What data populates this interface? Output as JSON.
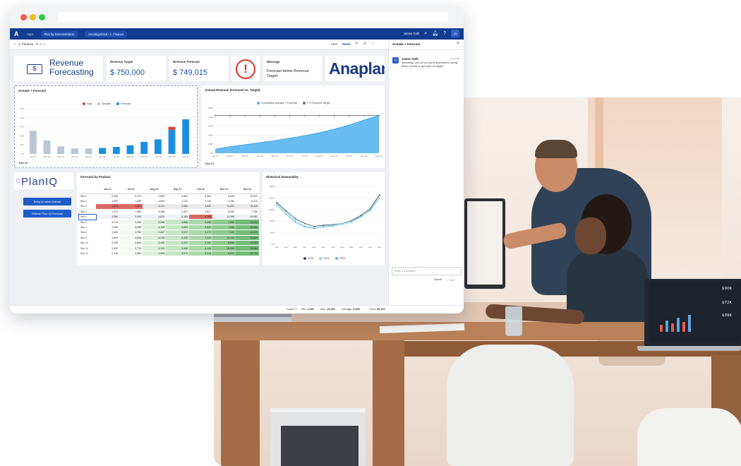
{
  "nav": {
    "logo": "A",
    "crumbs": [
      "Apps",
      "Plan by Demonstration",
      "Uncategorized › 1. Finance"
    ],
    "user": "James Goth",
    "avatar": "JG"
  },
  "toolbar": {
    "title": "1. Finance",
    "view": "View",
    "reset": "Reset"
  },
  "kpis": {
    "revenue_title_line1": "Revenue",
    "revenue_title_line2": "Forecasting",
    "target_label": "Revenue Target",
    "target_value": "$ 750,000",
    "forecast_label": "Revenue Forecast",
    "forecast_value": "$ 749,015",
    "message_label": "Message",
    "message_text": "Forecast below Revenue Target.",
    "brand": "Anaplan"
  },
  "actuals_chart": {
    "title": "Actuals + Forecast",
    "legend": [
      "Gap",
      "Actuals",
      "Forecast"
    ],
    "footer": "Dec 21",
    "colors": {
      "gap": "#d9433b",
      "actuals": "#b9c6d6",
      "forecast": "#1c8ee0"
    }
  },
  "annual_chart": {
    "title": "Annual Revenue (Forecast vs. Target)",
    "legend": [
      "Cumulative Actuals + Forecast",
      "FY Revenue Target"
    ],
    "footer": "Dec 21"
  },
  "planiq": {
    "logo": "PlanIQ",
    "btn_actuals": "Bring in Latest Actuals",
    "btn_refresh": "Refresh Plan IQ Forecast"
  },
  "table": {
    "title": "Forecast by Product",
    "columns": [
      "",
      "Jun 21",
      "Jul 21",
      "Aug 21",
      "Sep 21",
      "Oct 21",
      "Nov 21",
      "Dec 21"
    ],
    "rows": [
      {
        "label": "Sku 1",
        "cells": [
          "2,290",
          "2,374",
          "2,608",
          "4,842",
          "5,304",
          "6,649",
          "12,007"
        ]
      },
      {
        "label": "Sku 2",
        "cells": [
          "1,087",
          "1,698",
          "1,845",
          "2,110",
          "2,743",
          "3,782",
          "6,214"
        ]
      },
      {
        "label": "Sku 3",
        "cells": [
          "2,813",
          "2,891",
          "3,141",
          "3,384",
          "3,849",
          "11,601",
          "15,419"
        ]
      },
      {
        "label": "Sku 4",
        "cells": [
          "1,371",
          "1,486",
          "3,936",
          "3,197",
          "3,817",
          "5,090",
          "7,780"
        ]
      },
      {
        "label": "Sku 5",
        "cells": [
          "3,280",
          "3,394",
          "4,830",
          "5,182",
          "8,153",
          "11,098",
          "19,652"
        ]
      },
      {
        "label": "Sku 6",
        "cells": [
          "3,170",
          "3,259",
          "3,098",
          "4,088",
          "5,458",
          "7,690",
          "13,400"
        ]
      },
      {
        "label": "Sku 7",
        "cells": [
          "2,300",
          "2,535",
          "3,108",
          "3,893",
          "5,830",
          "7,698",
          "10,280"
        ]
      },
      {
        "label": "Sku 8",
        "cells": [
          "1,600",
          "1,781",
          "2,467",
          "3,097",
          "3,372",
          "7,130",
          "11,321"
        ]
      },
      {
        "label": "Sku 9",
        "cells": [
          "2,809",
          "3,028",
          "4,235",
          "5,392",
          "7,239",
          "12,230",
          "16,557"
        ]
      },
      {
        "label": "Sku 10",
        "cells": [
          "2,298",
          "2,614",
          "3,426",
          "4,302",
          "5,251",
          "8,896",
          "13,489"
        ]
      },
      {
        "label": "Sku 11",
        "cells": [
          "2,532",
          "2,713",
          "3,193",
          "3,969",
          "6,128",
          "10,930",
          "15,282"
        ]
      },
      {
        "label": "Sku 12",
        "cells": [
          "2,136",
          "2,381",
          "3,088",
          "3,872",
          "5,248",
          "8,691",
          "12,710"
        ]
      }
    ]
  },
  "seasonality": {
    "title": "Historical Seasonality",
    "legend": [
      "2018",
      "2019",
      "2020"
    ]
  },
  "comments": {
    "panel_title": "Actuals + Forecast",
    "author": "James Goth",
    "time": "Just now",
    "text": "Marketing, can we run some promotions during these months to get back on target?",
    "input_placeholder": "Enter a comment...",
    "cancel": "Cancel",
    "post": "Post"
  },
  "status": {
    "count_label": "Count:",
    "count": "7",
    "min_label": "Min:",
    "min": "2,290",
    "max_label": "Max:",
    "max": "19,652",
    "avg_label": "Average:",
    "avg": "8,499",
    "sum_label": "Sum:",
    "sum": "59,491"
  },
  "chart_data": [
    {
      "type": "bar",
      "title": "Actuals + Forecast",
      "categories": [
        "Jan 21",
        "Feb 21",
        "Mar 21",
        "Apr 21",
        "May 21",
        "Jun 21",
        "Jul 21",
        "Aug 21",
        "Sep 21",
        "Oct 21",
        "Nov 21",
        "Dec 21"
      ],
      "series": [
        {
          "name": "Actuals",
          "values": [
            46,
            27,
            15,
            11,
            11,
            0,
            0,
            0,
            0,
            0,
            0,
            0
          ]
        },
        {
          "name": "Forecast",
          "values": [
            0,
            0,
            0,
            0,
            0,
            12,
            14,
            17,
            24,
            29,
            48,
            69
          ]
        },
        {
          "name": "Gap",
          "values": [
            0,
            0,
            0,
            0,
            0,
            0,
            0,
            0,
            0,
            0,
            6,
            0
          ]
        }
      ],
      "ylim": [
        0,
        90
      ]
    },
    {
      "type": "area",
      "title": "Annual Revenue (Forecast vs. Target)",
      "categories": [
        "Jan 21",
        "Feb 21",
        "Mar 21",
        "Apr 21",
        "May 21",
        "Jun 21",
        "Jul 21",
        "Aug 21",
        "Sep 21",
        "Oct 21",
        "Nov 21",
        "Dec 21"
      ],
      "series": [
        {
          "name": "Cumulative Actuals + Forecast",
          "values": [
            8,
            13,
            17,
            21,
            25,
            30,
            35,
            41,
            48,
            56,
            66,
            75
          ]
        },
        {
          "name": "FY Revenue Target",
          "values": [
            75,
            75,
            75,
            75,
            75,
            75,
            75,
            75,
            75,
            75,
            75,
            75
          ]
        }
      ],
      "ylim": [
        0,
        90
      ]
    },
    {
      "type": "line",
      "title": "Historical Seasonality",
      "categories": [
        "Jan",
        "Feb",
        "Mar",
        "Apr",
        "May",
        "Jun",
        "Jul",
        "Aug",
        "Sep",
        "Oct",
        "Nov",
        "Dec"
      ],
      "series": [
        {
          "name": "2018",
          "values": [
            72,
            58,
            44,
            36,
            31,
            33,
            34,
            36,
            41,
            50,
            62,
            86
          ]
        },
        {
          "name": "2019",
          "values": [
            70,
            55,
            40,
            32,
            28,
            30,
            31,
            34,
            38,
            47,
            60,
            84
          ]
        },
        {
          "name": "2020",
          "values": [
            68,
            52,
            38,
            30,
            27,
            31,
            33,
            36,
            40,
            48,
            58,
            80
          ]
        }
      ],
      "ylim": [
        0,
        100
      ]
    }
  ]
}
